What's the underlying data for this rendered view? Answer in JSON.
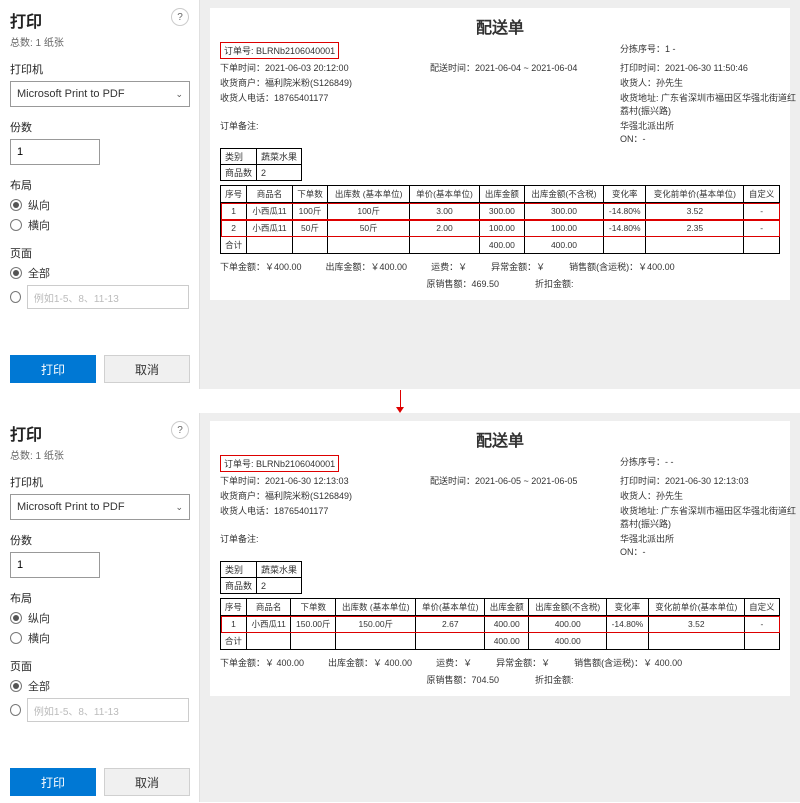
{
  "sidebar": {
    "title": "打印",
    "total_label": "总数: 1 纸张",
    "printer_label": "打印机",
    "printer_value": "Microsoft Print to PDF",
    "copies_label": "份数",
    "copies_value": "1",
    "layout_label": "布局",
    "layout_portrait": "纵向",
    "layout_landscape": "横向",
    "pages_label": "页面",
    "pages_all": "全部",
    "pages_placeholder": "例如1-5、8、11-13",
    "print_btn": "打印",
    "cancel_btn": "取消"
  },
  "doc1": {
    "title": "配送单",
    "order_no_label": "订单号:",
    "order_no": "BLRNb2106040001",
    "sort_seq": "分拣序号：1 -",
    "placed_time": "下单时间：2021-06-03 20:12:00",
    "delivery_time": "配送时间：2021-06-04 ~ 2021-06-04",
    "print_time": "打印时间：2021-06-30 11:50:46",
    "merchant": "收货商户：福利院米粉(S126849)",
    "receiver": "收货人：孙先生",
    "phone": "收货人电话：18765401177",
    "address": "收货地址: 广东省深圳市福田区华强北街道红荔村(振兴路)",
    "police": "华强北派出所",
    "note": "订单备注:",
    "on": "ON：-",
    "category_label": "类别",
    "category": "蔬菜水果",
    "goods_count_label": "商品数",
    "goods_count": "2",
    "headers": [
      "序号",
      "商品名",
      "下单数",
      "出库数\n(基本单位)",
      "单价(基本单位)",
      "出库金额",
      "出库金额(不含税)",
      "变化率",
      "变化前单价(基本单位)",
      "自定义"
    ],
    "rows": [
      {
        "seq": "1",
        "name": "小西瓜11",
        "order_qty": "100斤",
        "out_qty": "100斤",
        "price": "3.00",
        "out_amt": "300.00",
        "out_amt_notax": "300.00",
        "rate": "-14.80%",
        "prev_price": "3.52",
        "custom": "-"
      },
      {
        "seq": "2",
        "name": "小西瓜11",
        "order_qty": "50斤",
        "out_qty": "50斤",
        "price": "2.00",
        "out_amt": "100.00",
        "out_amt_notax": "100.00",
        "rate": "-14.80%",
        "prev_price": "2.35",
        "custom": "-"
      }
    ],
    "total_label": "合计",
    "total_out": "400.00",
    "total_out_notax": "400.00",
    "footer_order_amt": "下单金额：￥400.00",
    "footer_out_amt": "出库金额：￥400.00",
    "footer_freight": "运费：￥",
    "footer_abnormal": "异常金额：￥",
    "footer_sale_amt": "销售额(含运税)：￥400.00",
    "footer_orig_sale": "原销售额：469.50",
    "footer_discount": "折扣金额:"
  },
  "doc2": {
    "title": "配送单",
    "order_no_label": "订单号:",
    "order_no": "BLRNb2106040001",
    "sort_seq": "分拣序号：- -",
    "placed_time": "下单时间：2021-06-30 12:13:03",
    "delivery_time": "配送时间：2021-06-05 ~ 2021-06-05",
    "print_time": "打印时间：2021-06-30 12:13:03",
    "merchant": "收货商户：福利院米粉(S126849)",
    "receiver": "收货人：孙先生",
    "phone": "收货人电话：18765401177",
    "address": "收货地址: 广东省深圳市福田区华强北街道红荔村(振兴路)",
    "police": "华强北派出所",
    "note": "订单备注:",
    "on": "ON：-",
    "category_label": "类别",
    "category": "蔬菜水果",
    "goods_count_label": "商品数",
    "goods_count": "2",
    "headers": [
      "序号",
      "商品名",
      "下单数",
      "出库数\n(基本单位)",
      "单价(基本单位)",
      "出库金额",
      "出库金额(不含税)",
      "变化率",
      "变化前单价(基本单位)",
      "自定义"
    ],
    "rows": [
      {
        "seq": "1",
        "name": "小西瓜11",
        "order_qty": "150.00斤",
        "out_qty": "150.00斤",
        "price": "2.67",
        "out_amt": "400.00",
        "out_amt_notax": "400.00",
        "rate": "-14.80%",
        "prev_price": "3.52",
        "custom": "-"
      }
    ],
    "total_label": "合计",
    "total_out": "400.00",
    "total_out_notax": "400.00",
    "footer_order_amt": "下单金额：￥ 400.00",
    "footer_out_amt": "出库金额：￥ 400.00",
    "footer_freight": "运费：￥",
    "footer_abnormal": "异常金额：￥",
    "footer_sale_amt": "销售额(含运税)：￥ 400.00",
    "footer_orig_sale": "原销售额：704.50",
    "footer_discount": "折扣金额:"
  }
}
